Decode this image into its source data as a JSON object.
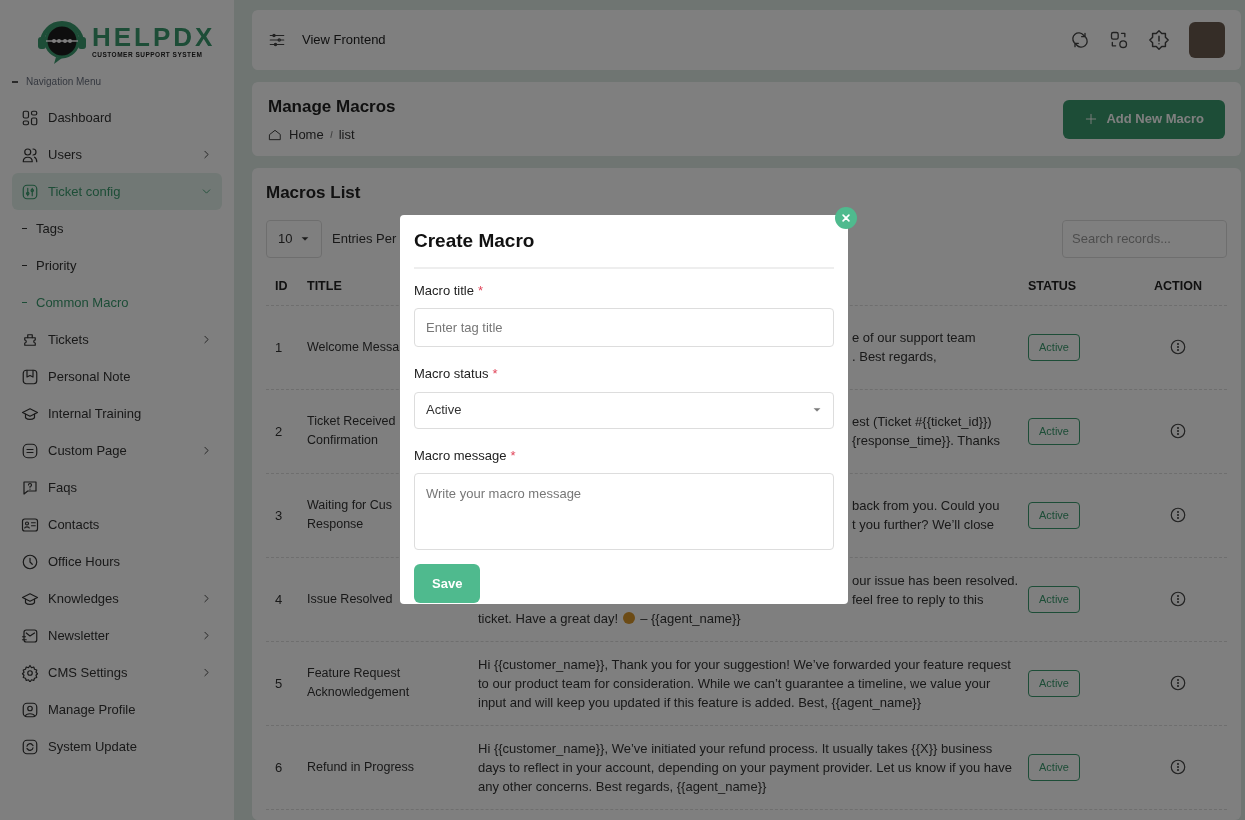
{
  "sidebar": {
    "logo": {
      "name": "HELPDX",
      "tagline": "CUSTOMER SUPPORT SYSTEM"
    },
    "section_label": "Navigation Menu",
    "items": [
      {
        "label": "Dashboard",
        "selected": false
      },
      {
        "label": "Users",
        "selected": false,
        "expanded": false
      },
      {
        "label": "Ticket config",
        "selected": true,
        "expanded": true,
        "children": [
          {
            "label": "Tags",
            "selected": false
          },
          {
            "label": "Priority",
            "selected": false
          },
          {
            "label": "Common Macro",
            "selected": true
          }
        ]
      },
      {
        "label": "Tickets",
        "selected": false,
        "expanded": false
      },
      {
        "label": "Personal Note",
        "selected": false
      },
      {
        "label": "Internal Training",
        "selected": false
      },
      {
        "label": "Custom Page",
        "selected": false,
        "expanded": false
      },
      {
        "label": "Faqs",
        "selected": false
      },
      {
        "label": "Contacts",
        "selected": false
      },
      {
        "label": "Office Hours",
        "selected": false
      },
      {
        "label": "Knowledges",
        "selected": false,
        "expanded": false
      },
      {
        "label": "Newsletter",
        "selected": false,
        "expanded": false
      },
      {
        "label": "CMS Settings",
        "selected": false,
        "expanded": false
      },
      {
        "label": "Manage Profile",
        "selected": false
      },
      {
        "label": "System Update",
        "selected": false
      }
    ]
  },
  "topbar": {
    "link": "View Frontend"
  },
  "page_header": {
    "title": "Manage Macros",
    "breadcrumb": [
      "Home",
      "list"
    ],
    "add_button": "Add New Macro"
  },
  "macros": {
    "title": "Macros List",
    "entries_select": "10",
    "entries_label": "Entries Per",
    "search_placeholder": "Search records...",
    "columns": [
      "ID",
      "TITLE",
      "STATUS",
      "ACTION"
    ],
    "rows": [
      {
        "id": "1",
        "title": "Welcome Messa",
        "message": [
          {
            "text": "e of our support team\n. Best regards,",
            "clipped": true
          }
        ],
        "status": "Active"
      },
      {
        "id": "2",
        "title": "Ticket Received\nConfirmation",
        "message": [
          {
            "text": "est (Ticket #{{ticket_id}})\n{response_time}}. Thanks",
            "clipped": true
          }
        ],
        "status": "Active"
      },
      {
        "id": "3",
        "title": "Waiting for Cus\nResponse",
        "message": [
          {
            "text": "back from you. Could you\nt you further? We’ll close",
            "clipped": true
          }
        ],
        "status": "Active"
      },
      {
        "id": "4",
        "title": "Issue Resolved",
        "message": [
          {
            "text": "our issue has been resolved.\nfeel free to reply to this",
            "clipped": true
          },
          {
            "text": "ticket. Have a great day!",
            "clipped": false,
            "emoji": true,
            "suffix": "– {{agent_name}}"
          }
        ],
        "status": "Active"
      },
      {
        "id": "5",
        "title": "Feature Request\nAcknowledgement",
        "message": [
          {
            "text": "Hi {{customer_name}}, Thank you for your suggestion! We’ve forwarded your feature request to our product team for consideration. While we can’t guarantee a timeline, we value your input and will keep you updated if this feature is added. Best, {{agent_name}}",
            "clipped": false
          }
        ],
        "status": "Active"
      },
      {
        "id": "6",
        "title": "Refund in Progress",
        "message": [
          {
            "text": "Hi {{customer_name}}, We’ve initiated your refund process. It usually takes {{X}} business days to reflect in your account, depending on your payment provider. Let us know if you have any other concerns. Best regards, {{agent_name}}",
            "clipped": false
          }
        ],
        "status": "Active"
      }
    ]
  },
  "modal": {
    "title": "Create Macro",
    "fields": [
      {
        "kind": "input",
        "label": "Macro title",
        "required": true,
        "placeholder": "Enter tag title"
      },
      {
        "kind": "select",
        "label": "Macro status",
        "required": true,
        "value": "Active"
      },
      {
        "kind": "textarea",
        "label": "Macro message",
        "required": true,
        "placeholder": "Write your macro message"
      }
    ],
    "required_mark": "*",
    "save_button": "Save"
  }
}
